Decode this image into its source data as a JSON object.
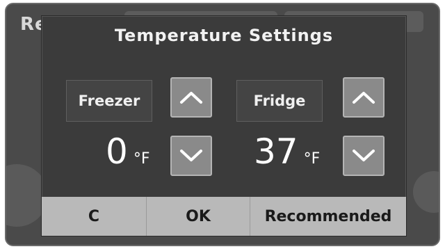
{
  "background": {
    "title_fragment": "Re"
  },
  "dialog": {
    "title": "Temperature Settings",
    "freezer": {
      "label": "Freezer",
      "value": "0",
      "unit": "°F",
      "up_icon": "chevron-up-icon",
      "down_icon": "chevron-down-icon"
    },
    "fridge": {
      "label": "Fridge",
      "value": "37",
      "unit": "°F",
      "up_icon": "chevron-up-icon",
      "down_icon": "chevron-down-icon"
    },
    "footer": {
      "c_label": "C",
      "ok_label": "OK",
      "recommended_label": "Recommended"
    }
  },
  "colors": {
    "dialog_bg": "#3b3b3b",
    "button_bg": "#8a8a8a",
    "footer_bg": "#b9b9b9",
    "text_light": "#f2f2f2"
  }
}
